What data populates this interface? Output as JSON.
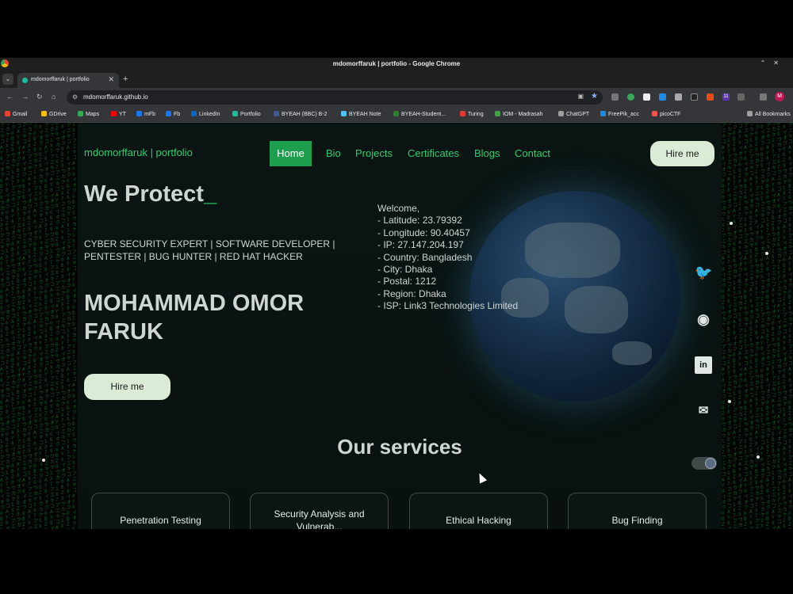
{
  "window": {
    "title": "mdomorffaruk | portfolio - Google Chrome",
    "tab_title": "mdomorffaruk | portfolio",
    "url": "mdomorffaruk.github.io",
    "profile_initial": "M",
    "ext_badge": "11"
  },
  "bookmarks": [
    {
      "label": "Gmail",
      "color": "#ea4335"
    },
    {
      "label": "GDrive",
      "color": "#fbbc04"
    },
    {
      "label": "Maps",
      "color": "#34a853"
    },
    {
      "label": "YT",
      "color": "#ff0000"
    },
    {
      "label": "mFb",
      "color": "#1877f2"
    },
    {
      "label": "Fb",
      "color": "#1877f2"
    },
    {
      "label": "LinkedIn",
      "color": "#0a66c2"
    },
    {
      "label": "Portfolio",
      "color": "#1abc9c"
    },
    {
      "label": "BYEAH (BBC) B-2",
      "color": "#3b5998"
    },
    {
      "label": "BYEAH Note",
      "color": "#4fc3f7"
    },
    {
      "label": "BYEAH-Student...",
      "color": "#2e7d32"
    },
    {
      "label": "Turing",
      "color": "#e53935"
    },
    {
      "label": "IOM - Madrasah",
      "color": "#43a047"
    },
    {
      "label": "ChatGPT",
      "color": "#9e9e9e"
    },
    {
      "label": "FreePik_acc",
      "color": "#1e88e5"
    },
    {
      "label": "picoCTF",
      "color": "#ef5350"
    },
    {
      "label": "All Bookmarks",
      "color": "#9e9e9e"
    }
  ],
  "site": {
    "logo": "mdomorffaruk | portfolio",
    "nav": [
      "Home",
      "Bio",
      "Projects",
      "Certificates",
      "Blogs",
      "Contact"
    ],
    "hire_label": "Hire me",
    "headline": "We Protect",
    "headline_cursor": "_",
    "subtitle": "CYBER SECURITY EXPERT | SOFTWARE DEVELOPER | PENTESTER | BUG HUNTER | RED HAT HACKER",
    "name": "MOHAMMAD OMOR FARUK",
    "info": "Welcome,\n- Latitude: 23.79392\n- Longitude: 90.40457\n- IP: 27.147.204.197\n- Country: Bangladesh\n- City: Dhaka\n- Postal: 1212\n- Region: Dhaka\n- ISP: Link3 Technologies Limited",
    "services_title": "Our services",
    "services": [
      "Penetration Testing",
      "Security Analysis and Vulnerab...",
      "Ethical Hacking",
      "Bug Finding"
    ],
    "accent_color": "#2ecc71"
  }
}
